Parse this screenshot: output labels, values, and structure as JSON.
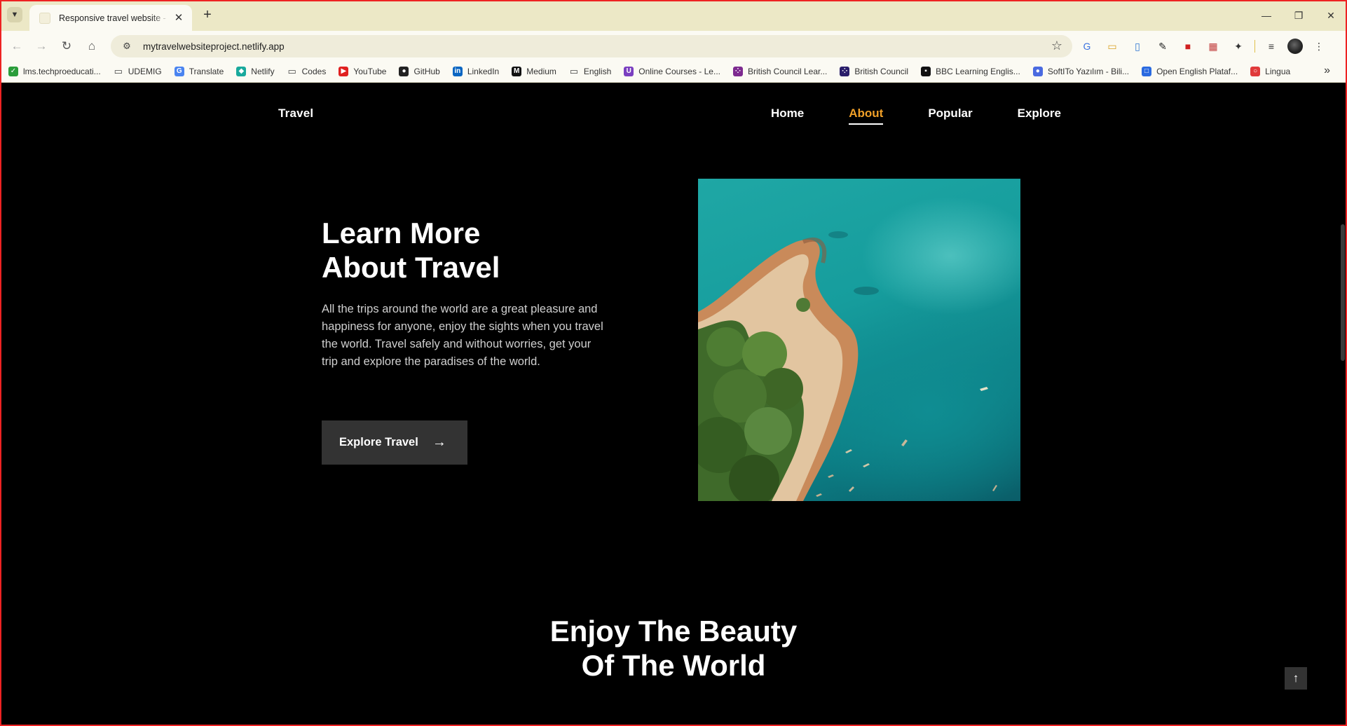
{
  "browser": {
    "tab_title": "Responsive travel website - Bedimcode",
    "url": "mytravelwebsiteproject.netlify.app",
    "bookmarks": [
      {
        "label": "lms.techproeducati...",
        "icon": "check-circle-icon",
        "color": "#2a9d3a"
      },
      {
        "label": "UDEMIG",
        "icon": "folder-icon",
        "color": ""
      },
      {
        "label": "Translate",
        "icon": "translate-icon",
        "color": "#4a84f0"
      },
      {
        "label": "Netlify",
        "icon": "netlify-icon",
        "color": "#19a99c"
      },
      {
        "label": "Codes",
        "icon": "folder-icon",
        "color": ""
      },
      {
        "label": "YouTube",
        "icon": "youtube-icon",
        "color": "#e02020"
      },
      {
        "label": "GitHub",
        "icon": "github-icon",
        "color": "#222222"
      },
      {
        "label": "LinkedIn",
        "icon": "linkedin-icon",
        "color": "#0a66c2"
      },
      {
        "label": "Medium",
        "icon": "medium-icon",
        "color": "#111111"
      },
      {
        "label": "English",
        "icon": "folder-icon",
        "color": ""
      },
      {
        "label": "Online Courses - Le...",
        "icon": "online-courses-icon",
        "color": "#7a3fc0"
      },
      {
        "label": "British Council Lear...",
        "icon": "british-council-icon",
        "color": "#7d2a8f"
      },
      {
        "label": "British Council",
        "icon": "british-council-icon",
        "color": "#2a1e6a"
      },
      {
        "label": "BBC Learning Englis...",
        "icon": "bbc-icon",
        "color": "#111111"
      },
      {
        "label": "SoftITo Yazılım - Bili...",
        "icon": "softito-icon",
        "color": "#4a6ae0"
      },
      {
        "label": "Open English Plataf...",
        "icon": "open-english-icon",
        "color": "#2a6ae0"
      },
      {
        "label": "Lingua",
        "icon": "lingua-icon",
        "color": "#e03a3a"
      }
    ]
  },
  "site": {
    "logo": "Travel",
    "nav": [
      {
        "label": "Home",
        "active": false
      },
      {
        "label": "About",
        "active": true
      },
      {
        "label": "Popular",
        "active": false
      },
      {
        "label": "Explore",
        "active": false
      }
    ],
    "about": {
      "title_line1": "Learn More",
      "title_line2": "About Travel",
      "description": "All the trips around the world are a great pleasure and happiness for anyone, enjoy the sights when you travel the world. Travel safely and without worries, get your trip and explore the paradises of the world.",
      "button_label": "Explore Travel",
      "image_icon": "aerial-island-photo"
    },
    "section2": {
      "title_line1": "Enjoy The Beauty",
      "title_line2": "Of The World"
    },
    "accent_color": "#f0a028"
  }
}
